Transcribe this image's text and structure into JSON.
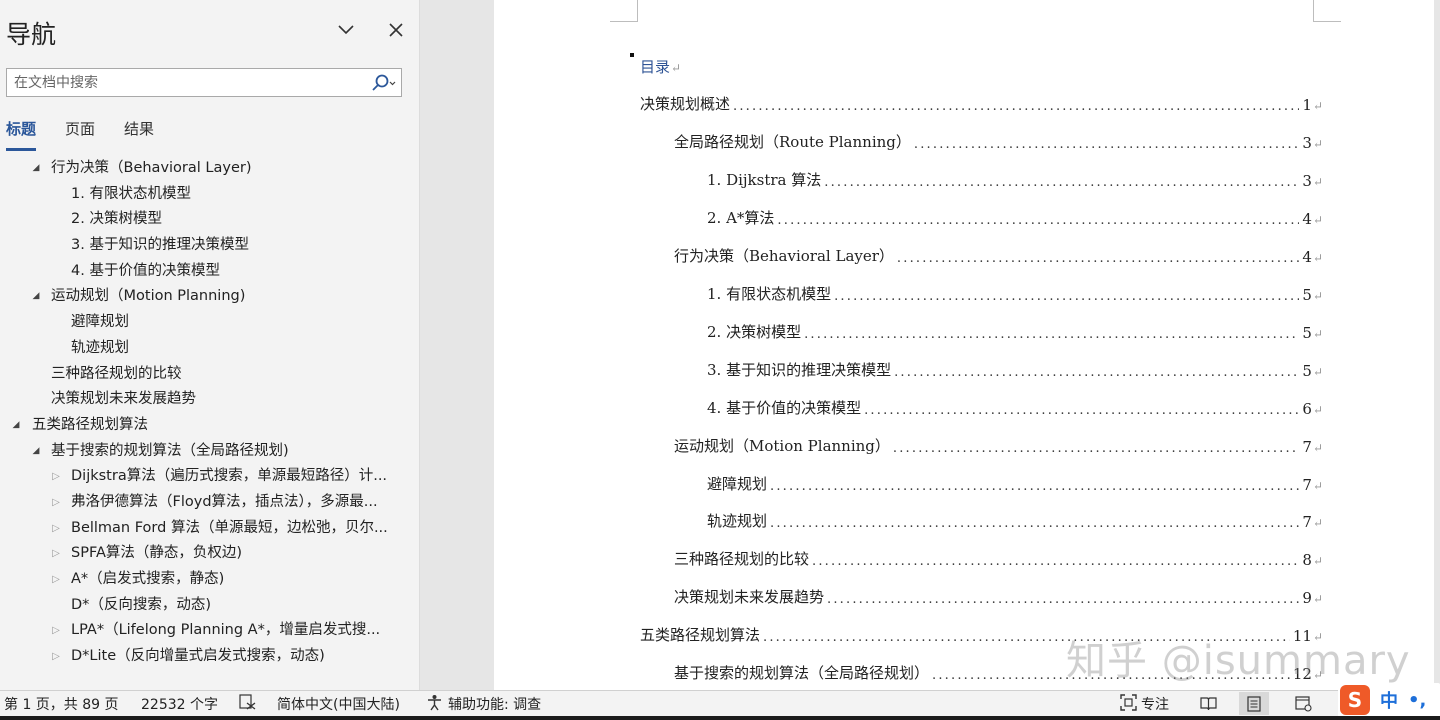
{
  "nav": {
    "title": "导航",
    "search_placeholder": "在文档中搜索",
    "tabs": [
      {
        "label": "标题",
        "active": true
      },
      {
        "label": "页面",
        "active": false
      },
      {
        "label": "结果",
        "active": false
      }
    ],
    "tree": [
      {
        "text": "行为决策（Behavioral Layer)",
        "level": 1,
        "arrow": "expanded"
      },
      {
        "text": "1. 有限状态机模型",
        "level": 2,
        "arrow": "none"
      },
      {
        "text": "2. 决策树模型",
        "level": 2,
        "arrow": "none"
      },
      {
        "text": "3. 基于知识的推理决策模型",
        "level": 2,
        "arrow": "none"
      },
      {
        "text": "4. 基于价值的决策模型",
        "level": 2,
        "arrow": "none"
      },
      {
        "text": "运动规划（Motion Planning)",
        "level": 1,
        "arrow": "expanded"
      },
      {
        "text": "避障规划",
        "level": 2,
        "arrow": "none"
      },
      {
        "text": "轨迹规划",
        "level": 2,
        "arrow": "none"
      },
      {
        "text": "三种路径规划的比较",
        "level": 1,
        "arrow": "none"
      },
      {
        "text": "决策规划未来发展趋势",
        "level": 1,
        "arrow": "none"
      },
      {
        "text": "五类路径规划算法",
        "level": 0,
        "arrow": "expanded"
      },
      {
        "text": "基于搜索的规划算法（全局路径规划)",
        "level": 1,
        "arrow": "expanded"
      },
      {
        "text": "Dijkstra算法（遍历式搜索，单源最短路径）计...",
        "level": 2,
        "arrow": "collapsed"
      },
      {
        "text": "弗洛伊德算法（Floyd算法，插点法），多源最...",
        "level": 2,
        "arrow": "collapsed"
      },
      {
        "text": "Bellman Ford 算法（单源最短，边松弛，贝尔...",
        "level": 2,
        "arrow": "collapsed"
      },
      {
        "text": "SPFA算法（静态，负权边)",
        "level": 2,
        "arrow": "collapsed"
      },
      {
        "text": "A*（启发式搜索，静态)",
        "level": 2,
        "arrow": "collapsed"
      },
      {
        "text": "D*（反向搜索，动态)",
        "level": 2,
        "arrow": "none"
      },
      {
        "text": "LPA*（Lifelong Planning A*，增量启发式搜...",
        "level": 2,
        "arrow": "collapsed"
      },
      {
        "text": "D*Lite（反向增量式启发式搜索，动态)",
        "level": 2,
        "arrow": "collapsed"
      }
    ]
  },
  "document": {
    "toc_heading": "目录",
    "toc": [
      {
        "text": "决策规划概述",
        "page": "1",
        "level": 0
      },
      {
        "text": "全局路径规划（Route Planning）",
        "page": "3",
        "level": 1
      },
      {
        "text": "1.  Dijkstra 算法",
        "page": "3",
        "level": 2
      },
      {
        "text": "2.  A*算法",
        "page": "4",
        "level": 2
      },
      {
        "text": "行为决策（Behavioral Layer）",
        "page": "4",
        "level": 1
      },
      {
        "text": "1.  有限状态机模型",
        "page": "5",
        "level": 2
      },
      {
        "text": "2.  决策树模型",
        "page": "5",
        "level": 2
      },
      {
        "text": "3.  基于知识的推理决策模型",
        "page": "5",
        "level": 2
      },
      {
        "text": "4.  基于价值的决策模型",
        "page": "6",
        "level": 2
      },
      {
        "text": "运动规划（Motion Planning）",
        "page": "7",
        "level": 1
      },
      {
        "text": "避障规划",
        "page": "7",
        "level": 2
      },
      {
        "text": "轨迹规划",
        "page": "7",
        "level": 2
      },
      {
        "text": "三种路径规划的比较",
        "page": "8",
        "level": 1
      },
      {
        "text": "决策规划未来发展趋势",
        "page": "9",
        "level": 1
      },
      {
        "text": "五类路径规划算法",
        "page": "11",
        "level": 0
      },
      {
        "text": "基于搜索的规划算法（全局路径规划）",
        "page": "12",
        "level": 1
      }
    ]
  },
  "watermark": "知乎 @isummary",
  "status": {
    "page_info": "第 1 页，共 89 页",
    "word_count": "22532 个字",
    "language": "简体中文(中国大陆)",
    "accessibility": "辅助功能: 调查",
    "focus": "专注"
  },
  "ime": {
    "logo": "S",
    "lang": "中",
    "punct": "•,"
  }
}
